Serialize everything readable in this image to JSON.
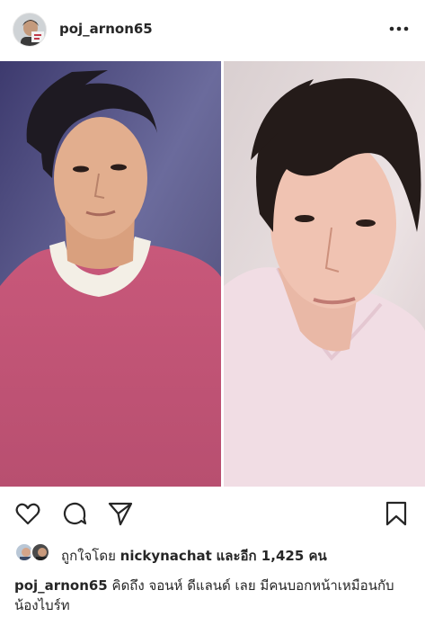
{
  "post": {
    "username": "poj_arnon65"
  },
  "likes": {
    "prefix": "ถูกใจโดย",
    "liker": "nickynachat",
    "suffix": "และอีก 1,425 คน"
  },
  "caption": {
    "username": "poj_arnon65",
    "text": "คิดถึง จอนห์ ดีแลนด์ เลย มีคนบอกหน้าเหมือนกับน้องไบร์ท"
  }
}
